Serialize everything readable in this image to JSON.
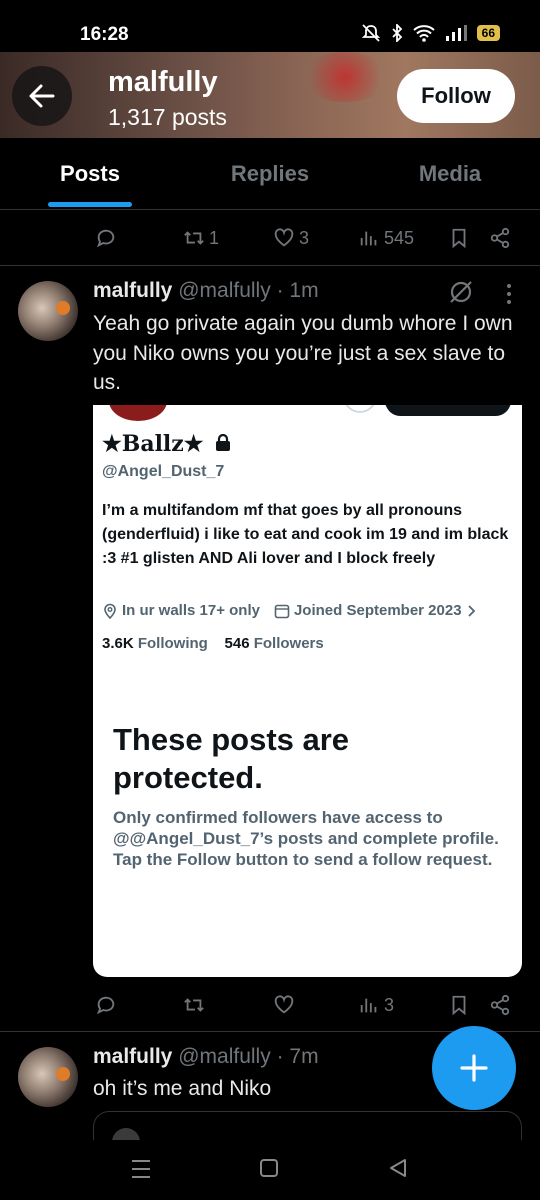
{
  "status_bar": {
    "time": "16:28",
    "battery": "66"
  },
  "header": {
    "name": "malfully",
    "posts": "1,317 posts",
    "follow_label": "Follow"
  },
  "tabs": [
    {
      "label": "Posts",
      "active": true
    },
    {
      "label": "Replies",
      "active": false
    },
    {
      "label": "Media",
      "active": false
    }
  ],
  "top_actions": {
    "retweets": "1",
    "likes": "3",
    "views": "545"
  },
  "post1": {
    "name": "malfully",
    "handle": "@malfully",
    "time": "· 1m",
    "text": "Yeah go private again you dumb whore I own you Niko owns you you’re just a sex slave to us.",
    "views": "3",
    "embedded": {
      "name": "★Ballz★",
      "handle": "@Angel_Dust_7",
      "bio": "I’m a multifandom mf that goes by all pronouns (genderfluid) i like to eat and cook im 19 and im black :3 #1 glisten AND Ali lover and I block freely",
      "location": "In ur walls 17+ only",
      "joined": "Joined September 2023",
      "following_count": "3.6K",
      "following_label": "Following",
      "followers_count": "546",
      "followers_label": "Followers",
      "protected_title": "These posts are protected.",
      "protected_text": "Only confirmed followers have access to @@Angel_Dust_7’s posts and complete profile. Tap the Follow button to send a follow request."
    }
  },
  "post2": {
    "name": "malfully",
    "handle": "@malfully",
    "time": "· 7m",
    "text": "oh it’s me and Niko"
  },
  "colors": {
    "accent": "#1d9bf0",
    "muted": "#71767b",
    "background": "#000000"
  }
}
